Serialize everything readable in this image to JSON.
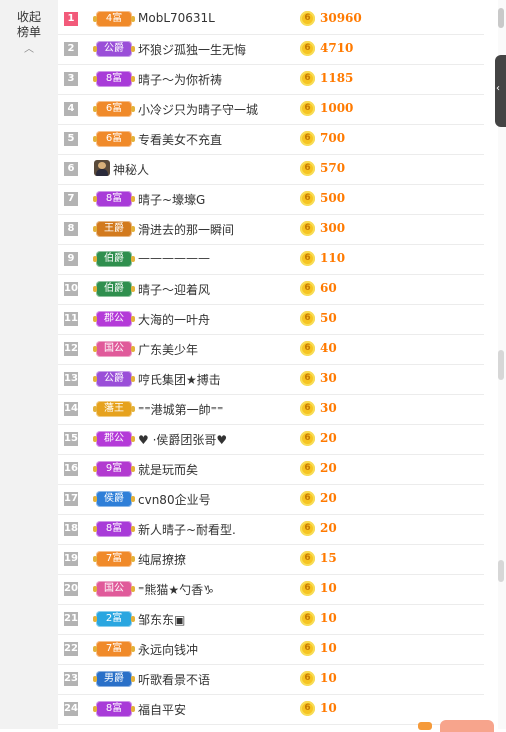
{
  "sidebar": {
    "collapse_label": "收起榜单",
    "chevron": "chevron-up-icon"
  },
  "colors": {
    "rank_first": "#f25a7a",
    "rank_default": "#b3b3b3",
    "score": "#ff7a00",
    "coin": "#f6c423"
  },
  "rows": [
    {
      "rank": "1",
      "badge": "4富",
      "badge_color": "#f08a2a",
      "name": "MobL70631L",
      "score": "30960"
    },
    {
      "rank": "2",
      "badge": "公爵",
      "badge_color": "#9a4fd8",
      "name": "坏狼ジ孤独一生无悔",
      "score": "4710"
    },
    {
      "rank": "3",
      "badge": "8富",
      "badge_color": "#a83bd8",
      "name": "晴子～为你祈祷",
      "score": "1185"
    },
    {
      "rank": "4",
      "badge": "6富",
      "badge_color": "#f08a2a",
      "name": "小冷ジ只为晴子守一城",
      "score": "1000"
    },
    {
      "rank": "5",
      "badge": "6富",
      "badge_color": "#f08a2a",
      "name": "专看美女不充直",
      "score": "700"
    },
    {
      "rank": "6",
      "badge": "",
      "badge_color": "",
      "name": "神秘人",
      "score": "570",
      "avatar": "mystery-avatar"
    },
    {
      "rank": "7",
      "badge": "8富",
      "badge_color": "#a83bd8",
      "name": "晴子~壕壕G",
      "score": "500"
    },
    {
      "rank": "8",
      "badge": "王爵",
      "badge_color": "#d27a1e",
      "name": "滑进去的那一瞬间",
      "score": "300"
    },
    {
      "rank": "9",
      "badge": "伯爵",
      "badge_color": "#2f8f4e",
      "name": "——————",
      "score": "110"
    },
    {
      "rank": "10",
      "badge": "伯爵",
      "badge_color": "#2f8f4e",
      "name": "晴子～迎着风",
      "score": "60"
    },
    {
      "rank": "11",
      "badge": "郡公",
      "badge_color": "#b43ad8",
      "name": "大海的一叶舟",
      "score": "50"
    },
    {
      "rank": "12",
      "badge": "国公",
      "badge_color": "#e05a9a",
      "name": "广东美少年",
      "score": "40"
    },
    {
      "rank": "13",
      "badge": "公爵",
      "badge_color": "#9a4fd8",
      "name": "哼氏集团★搏击",
      "score": "30"
    },
    {
      "rank": "14",
      "badge": "藩王",
      "badge_color": "#e6a21e",
      "name": "⁼⁼港城第一帥⁼⁼",
      "score": "30"
    },
    {
      "rank": "15",
      "badge": "郡公",
      "badge_color": "#b43ad8",
      "name": "♥ ·侯爵团张哥♥",
      "score": "20"
    },
    {
      "rank": "16",
      "badge": "9富",
      "badge_color": "#b23ad0",
      "name": "就是玩而矣",
      "score": "20"
    },
    {
      "rank": "17",
      "badge": "侯爵",
      "badge_color": "#2f7fd8",
      "name": "cvn80企业号",
      "score": "20"
    },
    {
      "rank": "18",
      "badge": "8富",
      "badge_color": "#a83bd8",
      "name": "新人晴子~耐看型.",
      "score": "20"
    },
    {
      "rank": "19",
      "badge": "7富",
      "badge_color": "#f08a2a",
      "name": "纯屌撩撩",
      "score": "15"
    },
    {
      "rank": "20",
      "badge": "国公",
      "badge_color": "#e05a9a",
      "name": "⁼熊猫★勺香♑",
      "score": "10"
    },
    {
      "rank": "21",
      "badge": "2富",
      "badge_color": "#2aa6e0",
      "name": "邹东东▣",
      "score": "10"
    },
    {
      "rank": "22",
      "badge": "7富",
      "badge_color": "#f08a2a",
      "name": "永远向钱冲",
      "score": "10"
    },
    {
      "rank": "23",
      "badge": "男爵",
      "badge_color": "#2a70c8",
      "name": "听歌看景不语",
      "score": "10"
    },
    {
      "rank": "24",
      "badge": "8富",
      "badge_color": "#a83bd8",
      "name": "福自平安",
      "score": "10"
    }
  ]
}
